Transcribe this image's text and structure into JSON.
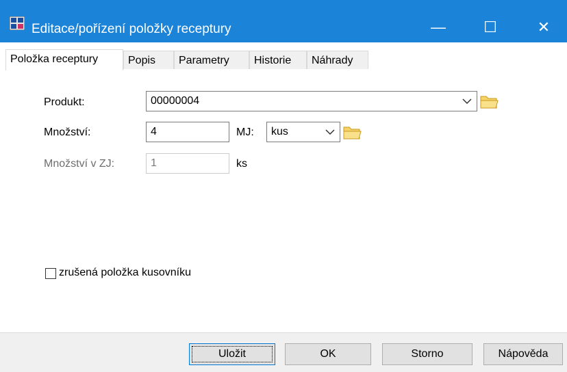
{
  "window": {
    "title": "Editace/pořízení položky receptury",
    "minimize_glyph": "—",
    "maximize_glyph": "☐",
    "close_glyph": "✕",
    "titlebar_color": "#1c84d8"
  },
  "tabs": [
    {
      "label": "Položka receptury",
      "active": true
    },
    {
      "label": "Popis"
    },
    {
      "label": "Parametry"
    },
    {
      "label": "Historie"
    },
    {
      "label": "Náhrady"
    }
  ],
  "form": {
    "produkt_label": "Produkt:",
    "produkt_value": "00000004",
    "mnozstvi_label": "Množství:",
    "mnozstvi_value": "4",
    "mj_label": "MJ:",
    "mj_value": "kus",
    "mnozstvi_zj_label": "Množství v ZJ:",
    "mnozstvi_zj_value": "1",
    "zj_unit": "ks",
    "checkbox_label": "zrušená položka kusovníku",
    "checkbox_checked": false
  },
  "buttons": {
    "save": "Uložit",
    "ok": "OK",
    "cancel": "Storno",
    "help": "Nápověda"
  }
}
